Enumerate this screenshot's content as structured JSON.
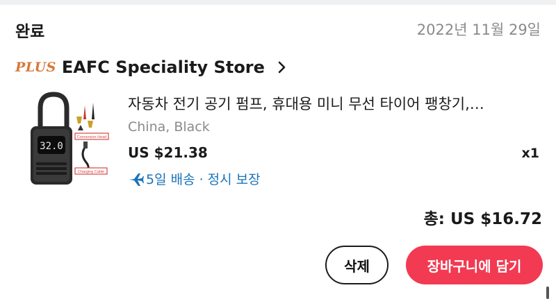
{
  "order": {
    "status": "완료",
    "date": "2022년 11월 29일"
  },
  "store": {
    "badge": "PLUS",
    "name": "EAFC Speciality Store",
    "chevron_icon": "chevron-right-icon"
  },
  "item": {
    "title": "자동차 전기 공기 펌프, 휴대용 미니 무선 타이어 팽창기,…",
    "variant": "China, Black",
    "price": "US $21.38",
    "quantity": "x1",
    "shipping_icon": "airplane-icon",
    "shipping": "5일 배송 · 정시 보장",
    "image": {
      "display_reading": "32.0",
      "label_conversion": "Conversion Head",
      "label_cable": "Charging Cable"
    }
  },
  "summary": {
    "total": "총: US $16.72"
  },
  "actions": {
    "delete_label": "삭제",
    "add_to_cart_label": "장바구니에 담기"
  },
  "colors": {
    "accent": "#f23a52",
    "plus_badge": "#d6793b",
    "shipping_text": "#1a73b9",
    "muted_text": "#8a8a8a"
  }
}
